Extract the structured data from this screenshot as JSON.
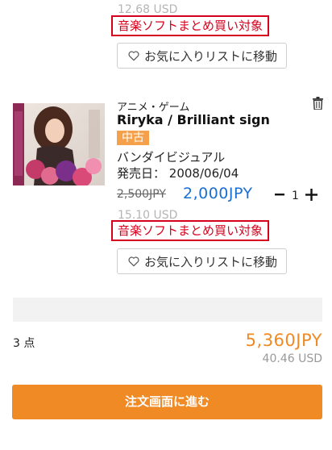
{
  "items": [
    {
      "usd_price": "12.68 USD",
      "campaign": "音楽ソフトまとめ買い対象",
      "favorite_label": "お気に入りリストに移動"
    },
    {
      "category": "アニメ・ゲーム",
      "title": "Riryka / Brilliant sign",
      "condition": "中古",
      "publisher": "バンダイビジュアル",
      "release_label": "発売日：",
      "release_date": "2008/06/04",
      "old_price": "2,500JPY",
      "price": "2,000JPY",
      "quantity": "1",
      "usd_price": "15.10 USD",
      "campaign": "音楽ソフトまとめ買い対象",
      "favorite_label": "お気に入りリストに移動"
    }
  ],
  "summary": {
    "count": "3 点",
    "total_jpy": "5,360JPY",
    "total_usd": "40.46 USD"
  },
  "order_button": "注文画面に進む",
  "colors": {
    "campaign_red": "#d6001c",
    "price_blue": "#1a6fd1",
    "accent_orange": "#f08a24",
    "badge_orange": "#f5a04a"
  },
  "icons": [
    "heart-icon",
    "trash-icon",
    "minus-icon",
    "plus-icon"
  ]
}
